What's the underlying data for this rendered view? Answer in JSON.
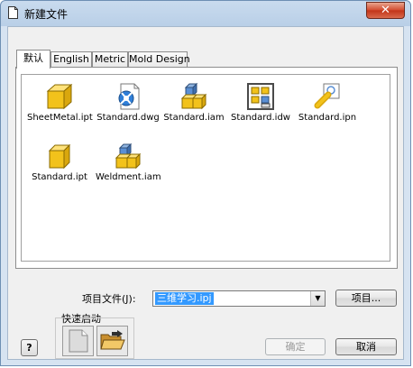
{
  "window": {
    "title": "新建文件",
    "close_glyph": "✕"
  },
  "tabs": [
    {
      "label": "默认",
      "active": true
    },
    {
      "label": "English",
      "active": false
    },
    {
      "label": "Metric",
      "active": false
    },
    {
      "label": "Mold Design",
      "active": false
    }
  ],
  "files": [
    {
      "name": "SheetMetal.ipt",
      "icon": "sheet-metal-part-icon"
    },
    {
      "name": "Standard.dwg",
      "icon": "drawing-dwg-icon"
    },
    {
      "name": "Standard.iam",
      "icon": "assembly-icon"
    },
    {
      "name": "Standard.idw",
      "icon": "drawing-idw-icon"
    },
    {
      "name": "Standard.ipn",
      "icon": "presentation-icon"
    },
    {
      "name": "Standard.ipt",
      "icon": "part-icon"
    },
    {
      "name": "Weldment.iam",
      "icon": "weldment-assembly-icon"
    }
  ],
  "project": {
    "label": "项目文件(J):",
    "value": "三维学习.ipj",
    "button_label": "项目..."
  },
  "quick_launch": {
    "label": "快速启动",
    "buttons": [
      "new-document-icon",
      "open-folder-icon"
    ]
  },
  "buttons": {
    "ok": "确定",
    "cancel": "取消",
    "help_glyph": "?"
  },
  "colors": {
    "selection": "#3399ff",
    "part_yellow": "#f2c21b",
    "close_red": "#c23418"
  }
}
